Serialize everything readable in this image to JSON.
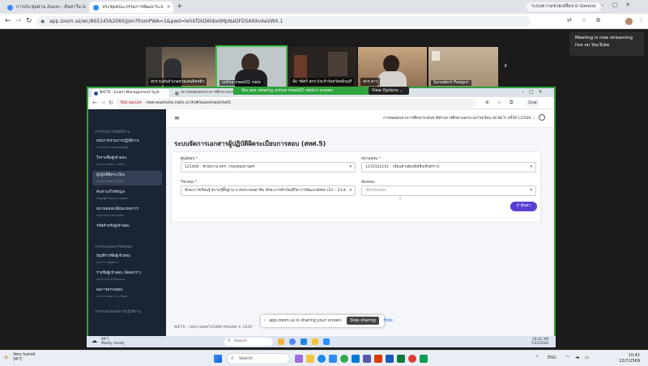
{
  "browser": {
    "tabs": [
      {
        "label": "การประชุมผ่าน Zoom - ค้นหาใน G"
      },
      {
        "label": "ประชุมคณะกรรมการพัฒนาระบ"
      }
    ],
    "search_chip": "ระบบความช่วยเหลือจาก Gemini",
    "url": "app.zoom.us/wc/86514562060/join?fromPWA=1&pwd=lehXf2kD6hbotMpNaGFD5A9Xv4aVWX.1"
  },
  "zoom": {
    "stream_notice": "Meeting is now streaming live on YouTube",
    "participants": [
      {
        "name": "สกร.ระดับอำเภอสามเสนดิตชย์ฯ"
      },
      {
        "name": "online-meet02 niets"
      },
      {
        "name": "อ้อ ฯพัตร์ สกร.ประจำจังหวัดสมินบุรี"
      },
      {
        "name": "สกร.สาว"
      },
      {
        "name": "Sunadech Pawgun"
      }
    ],
    "viewing_banner": "You are viewing  online-meet02 niets's screen",
    "view_options": "View Options",
    "share_notice": "app.zoom.us is sharing your screen.",
    "stop_sharing": "Stop sharing",
    "hide": "Hide"
  },
  "shared": {
    "tabs": [
      {
        "label": "NIETS - Exam Management Syst"
      },
      {
        "label": "สถาบันทดสอบทางการศึกษาแห่งชาติ"
      }
    ],
    "url_prefix": "Not secure",
    "url": "new-examsite.niets.or.th/#/examinee/ntet5",
    "chat_label": "Chat",
    "sidebar": {
      "section1": "ภาพรวมการปฏิบัติงาน",
      "items1": [
        {
          "title": "สรุปภาพรวมการปฏิบัติงาน",
          "sub": "ภาพรวมการสอบของศูนย์"
        },
        {
          "title": "ใบรายชื่อผู้เข้าสอบ",
          "sub": "เอกสาร สทศ.2, สทศ.3"
        },
        {
          "title": "ผู้ปฏิบัติผิดระเบียบ",
          "sub": "เอกสาร สทศ.5 (ใหม่)"
        },
        {
          "title": "ค้นหาแก้ไขข้อมูล",
          "sub": "ข้อมูลผู้เข้าสอบรายบุคคล"
        },
        {
          "title": "สนามสอบเปลี่ยนแปลงการ",
          "sub": "สรุปรายงานสนามสอบ"
        },
        {
          "title": "รหัสสำหรับผู้เข้าสอบ",
          "sub": ""
        }
      ],
      "section2": "ภาพรวมของการทดสอบ",
      "items2": [
        {
          "title": "บัญชีรายชื่อผู้เข้าสอบ",
          "sub": "เอกสาร Digital 1"
        },
        {
          "title": "รายชื่อผู้เข้าสอบ (จัดส่ง)ราว",
          "sub": "เอกสารประจำห้องสอบ"
        },
        {
          "title": "ผลการตรวจสอบ",
          "sub": "เอกสาร สทศ. ประเมินผล"
        }
      ],
      "section3": "ภาพรวมของผลการปฏิบัติงาน"
    },
    "header_title": "การทดสอบทางการศึกษาระดับชาติด้านการศึกษานอกระบบโรงเรียน (N-NET) ครั้งที่ 1/2569",
    "page_title": "ระบบจัดการเอกสารผู้ปฏิบัติผิดระเบียบการสอบ (สทศ.5)",
    "form": {
      "center_label": "ศูนย์สอบ *",
      "center_value": "121000 - สำนักงาน สกร. กรุงเทพมหานคร",
      "site_label": "สนามสอบ *",
      "site_value": "1210102101 - เขียนห้างต้องพิชชิ่ง(ชั่วคราว)",
      "subject_label": "วิชาสอบ *",
      "subject_value": "ทักษะการเรียนรู้ ความรู้พื้นฐาน การประกอบอาชีพ ทักษะการดำเนินชีวิต การพัฒนาสังคม (22 – 23 ส.",
      "room_label": "ห้องสอบ",
      "room_placeholder": "เลือกห้องสอบ",
      "search_label": "ค้นหา"
    },
    "footer": "NIETS - กลุ่มงานเทคโนโลยีสารสนเทศ © 2026",
    "taskbar": {
      "weather_temp": "99°F",
      "weather_desc": "Mostly cloudy",
      "search": "Search",
      "time": "10:42 AM",
      "date": "7/22/2026"
    }
  },
  "host_taskbar": {
    "weather_title": "Very humid",
    "weather_temp": "34°C",
    "search": "Search",
    "lang": "ENG",
    "time": "10:42",
    "date": "22/7/2569"
  }
}
